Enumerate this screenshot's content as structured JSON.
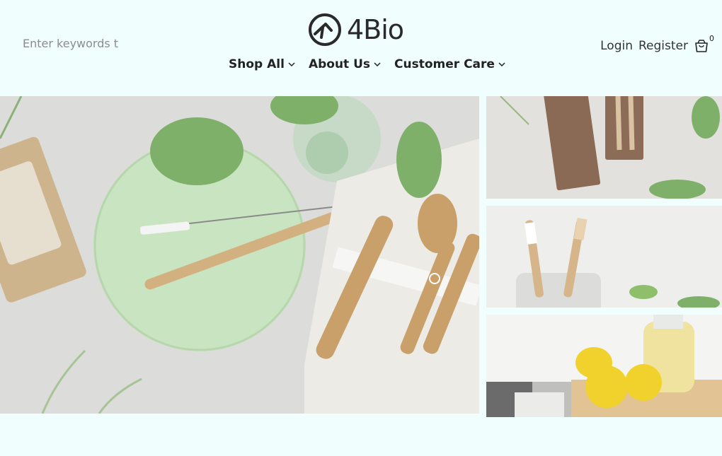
{
  "header": {
    "search_placeholder": "Enter keywords t",
    "logo_text": "4Bio",
    "nav": [
      {
        "label": "Shop All"
      },
      {
        "label": "About Us"
      },
      {
        "label": "Customer Care"
      }
    ],
    "login_label": "Login",
    "register_label": "Register",
    "cart_count": "0"
  },
  "colors": {
    "page_background": "#f0fffe",
    "text": "#222222"
  },
  "images": {
    "hero": "plate-with-bamboo-straw-and-cutlery",
    "tile1": "wooden-pen-box-with-pens",
    "tile2": "bamboo-toothbrushes-in-glass",
    "tile3": "lemons-and-juice-on-cutting-board"
  }
}
